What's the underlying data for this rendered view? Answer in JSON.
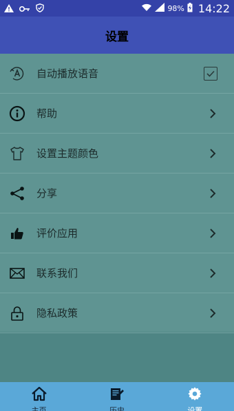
{
  "status_bar": {
    "battery": "98%",
    "time": "14:22"
  },
  "app_bar": {
    "title": "设置"
  },
  "settings": {
    "items": [
      {
        "label": "自动播放语音",
        "icon": "auto-play-icon",
        "control": "checkbox",
        "checked": true
      },
      {
        "label": "帮助",
        "icon": "info-icon",
        "control": "chevron"
      },
      {
        "label": "设置主题颜色",
        "icon": "tshirt-icon",
        "control": "chevron"
      },
      {
        "label": "分享",
        "icon": "share-icon",
        "control": "chevron"
      },
      {
        "label": "评价应用",
        "icon": "thumbs-up-icon",
        "control": "chevron"
      },
      {
        "label": "联系我们",
        "icon": "envelope-icon",
        "control": "chevron"
      },
      {
        "label": "隐私政策",
        "icon": "lock-icon",
        "control": "chevron"
      }
    ]
  },
  "bottom_nav": {
    "items": [
      {
        "label": "主页",
        "icon": "home-icon"
      },
      {
        "label": "历史",
        "icon": "history-icon"
      },
      {
        "label": "设置",
        "icon": "gear-icon",
        "active": true
      }
    ]
  },
  "colors": {
    "status_bar": "#3442a8",
    "app_bar": "#3f51b5",
    "list_bg": "#5f9492",
    "page_bg": "#4e8584",
    "bottom_nav": "#5aa8d8"
  }
}
